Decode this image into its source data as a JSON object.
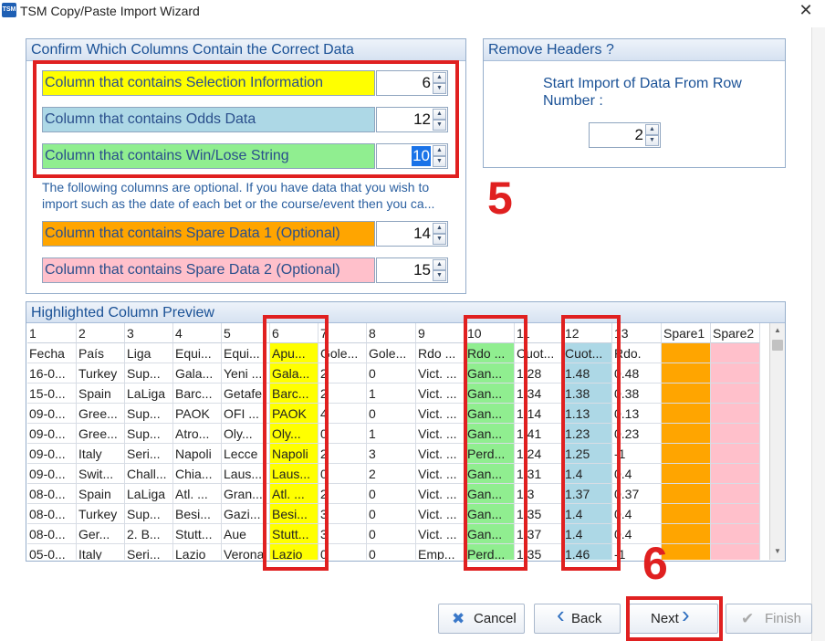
{
  "window": {
    "icon_text": "TSM",
    "title": "TSM Copy/Paste Import Wizard",
    "close": "✕"
  },
  "confirm_panel": {
    "title": "Confirm Which Columns Contain the Correct Data",
    "fields": [
      {
        "label": "Column that contains Selection Information",
        "value": "6",
        "color": "#ffff00"
      },
      {
        "label": "Column that contains Odds Data",
        "value": "12",
        "color": "#add8e6"
      },
      {
        "label": "Column that contains Win/Lose String",
        "value": "10",
        "color": "#90ee90"
      },
      {
        "label": "Column that contains Spare Data 1 (Optional)",
        "value": "14",
        "color": "#ffa500"
      },
      {
        "label": "Column that contains Spare Data 2 (Optional)",
        "value": "15",
        "color": "#ffc0cb"
      }
    ],
    "optional_note": "The following columns are optional. If you have data that you wish to import such as the date of each bet or the course/event then you ca..."
  },
  "remove_headers_panel": {
    "title": "Remove Headers ?",
    "instruction": "Start Import of Data From Row Number :",
    "value": "2"
  },
  "annotations": {
    "step5": "5",
    "step6": "6"
  },
  "preview_panel": {
    "title": "Highlighted Column Preview",
    "headers": [
      "1",
      "2",
      "3",
      "4",
      "5",
      "6",
      "7",
      "8",
      "9",
      "10",
      "11",
      "12",
      "13",
      "Spare1",
      "Spare2"
    ],
    "rows": [
      [
        "Fecha",
        "País",
        "Liga",
        "Equi...",
        "Equi...",
        "Apu...",
        "Gole...",
        "Gole...",
        "Rdo ...",
        "Rdo ...",
        "Cuot...",
        "Cuot...",
        "Rdo.",
        "",
        ""
      ],
      [
        "16-0...",
        "Turkey",
        "Sup...",
        "Gala...",
        "Yeni ...",
        "Gala...",
        "2",
        "0",
        "Vict. ...",
        "Gan...",
        "1.28",
        "1.48",
        "0.48",
        "",
        ""
      ],
      [
        "15-0...",
        "Spain",
        "LaLiga",
        "Barc...",
        "Getafe",
        "Barc...",
        "2",
        "1",
        "Vict. ...",
        "Gan...",
        "1.34",
        "1.38",
        "0.38",
        "",
        ""
      ],
      [
        "09-0...",
        "Gree...",
        "Sup...",
        "PAOK",
        "OFI ...",
        "PAOK",
        "4",
        "0",
        "Vict. ...",
        "Gan...",
        "1.14",
        "1.13",
        "0.13",
        "",
        ""
      ],
      [
        "09-0...",
        "Gree...",
        "Sup...",
        "Atro...",
        "Oly...",
        "Oly...",
        "0",
        "1",
        "Vict. ...",
        "Gan...",
        "1.41",
        "1.23",
        "0.23",
        "",
        ""
      ],
      [
        "09-0...",
        "Italy",
        "Seri...",
        "Napoli",
        "Lecce",
        "Napoli",
        "2",
        "3",
        "Vict. ...",
        "Perd...",
        "1.24",
        "1.25",
        "-1",
        "",
        ""
      ],
      [
        "09-0...",
        "Swit...",
        "Chall...",
        "Chia...",
        "Laus...",
        "Laus...",
        "0",
        "2",
        "Vict. ...",
        "Gan...",
        "1.31",
        "1.4",
        "0.4",
        "",
        ""
      ],
      [
        "08-0...",
        "Spain",
        "LaLiga",
        "Atl. ...",
        "Gran...",
        "Atl. ...",
        "2",
        "0",
        "Vict. ...",
        "Gan...",
        "1.3",
        "1.37",
        "0.37",
        "",
        ""
      ],
      [
        "08-0...",
        "Turkey",
        "Sup...",
        "Besi...",
        "Gazi...",
        "Besi...",
        "3",
        "0",
        "Vict. ...",
        "Gan...",
        "1.35",
        "1.4",
        "0.4",
        "",
        ""
      ],
      [
        "08-0...",
        "Ger...",
        "2. B...",
        "Stutt...",
        "Aue",
        "Stutt...",
        "3",
        "0",
        "Vict. ...",
        "Gan...",
        "1.37",
        "1.4",
        "0.4",
        "",
        ""
      ],
      [
        "05-0...",
        "Italy",
        "Seri...",
        "Lazio",
        "Verona",
        "Lazio",
        "0",
        "0",
        "Emp...",
        "Perd...",
        "1.35",
        "1.46",
        "-1",
        "",
        ""
      ]
    ]
  },
  "buttons": {
    "cancel": "Cancel",
    "back": "Back",
    "next": "Next",
    "finish": "Finish"
  },
  "icons": {
    "cancel": "✖",
    "back": "‹",
    "next": "›",
    "finish": "✔",
    "spin_up": "▲",
    "spin_down": "▼",
    "scroll_up": "▲",
    "scroll_down": "▼"
  },
  "colors": {
    "selection": "#ffff00",
    "odds": "#add8e6",
    "winlose": "#90ee90",
    "spare1": "#ffa500",
    "spare2": "#ffc0cb",
    "annotation_red": "#e02020"
  }
}
